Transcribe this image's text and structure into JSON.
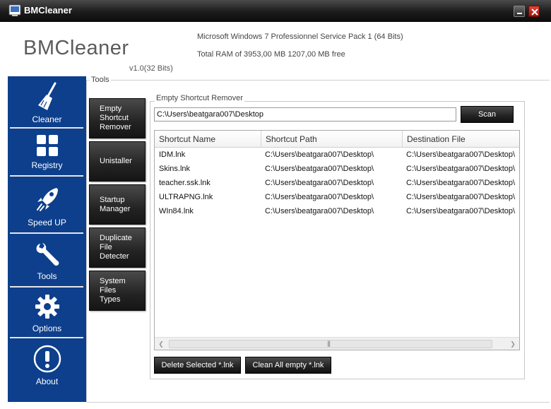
{
  "window": {
    "title": "BMCleaner"
  },
  "header": {
    "brand": "BMCleaner",
    "version": "v1.0(32 Bits)",
    "os_info": "Microsoft Windows 7 Professionnel  Service Pack 1 (64 Bits)",
    "ram_info": "Total RAM of 3953,00 MB 1207,00 MB free"
  },
  "sidebar": {
    "items": [
      {
        "label": "Cleaner",
        "icon": "broom-icon"
      },
      {
        "label": "Registry",
        "icon": "registry-grid-icon"
      },
      {
        "label": "Speed UP",
        "icon": "rocket-icon"
      },
      {
        "label": "Tools",
        "icon": "wrench-icon"
      },
      {
        "label": "Options",
        "icon": "gear-icon"
      },
      {
        "label": "About",
        "icon": "exclamation-icon"
      }
    ]
  },
  "tools": {
    "label": "Tools",
    "buttons": [
      {
        "lines": [
          "Empty",
          "Shortcut",
          "Remover"
        ]
      },
      {
        "lines": [
          "Unistaller"
        ]
      },
      {
        "lines": [
          "Startup",
          "Manager"
        ]
      },
      {
        "lines": [
          "Duplicate",
          "File",
          "Detecter"
        ]
      },
      {
        "lines": [
          "System",
          "Files",
          "Types"
        ]
      }
    ]
  },
  "panel": {
    "title": "Empty Shortcut Remover",
    "path_value": "C:\\Users\\beatgara007\\Desktop",
    "scan_label": "Scan",
    "columns": [
      "Shortcut Name",
      "Shortcut Path",
      "Destination File"
    ],
    "rows": [
      [
        "IDM.lnk",
        "C:\\Users\\beatgara007\\Desktop\\",
        "C:\\Users\\beatgara007\\Desktop\\"
      ],
      [
        "Skins.lnk",
        "C:\\Users\\beatgara007\\Desktop\\",
        "C:\\Users\\beatgara007\\Desktop\\"
      ],
      [
        "teacher.ssk.lnk",
        "C:\\Users\\beatgara007\\Desktop\\",
        "C:\\Users\\beatgara007\\Desktop\\"
      ],
      [
        "ULTRAPNG.lnk",
        "C:\\Users\\beatgara007\\Desktop\\",
        "C:\\Users\\beatgara007\\Desktop\\"
      ],
      [
        "WIn84.lnk",
        "C:\\Users\\beatgara007\\Desktop\\",
        "C:\\Users\\beatgara007\\Desktop\\"
      ]
    ],
    "delete_label": "Delete Selected *.lnk",
    "clean_label": "Clean All empty *.lnk"
  },
  "colors": {
    "sidebar": "#0d3f8c",
    "titlebar": "#1c1c1c",
    "close": "#c0241a"
  }
}
